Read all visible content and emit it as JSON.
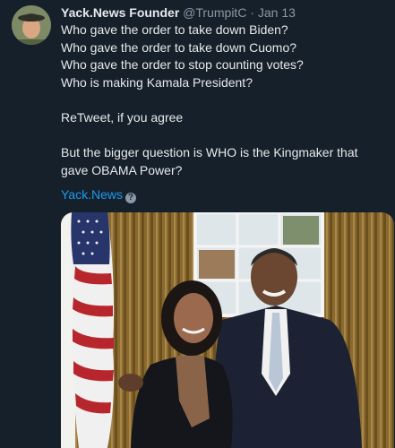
{
  "tweet": {
    "author": "Yack.News Founder",
    "handle": "@TrumpitC",
    "separator": "·",
    "date": "Jan 13",
    "lines": [
      "Who gave the order to take down Biden?",
      "Who gave the order to take down Cuomo?",
      "Who gave the order to stop counting votes?",
      "Who is making Kamala President?",
      "ReTweet, if you agree",
      "But the bigger question is WHO is the Kingmaker that",
      "gave OBAMA Power?"
    ],
    "link_text": "Yack.News",
    "badge_icon": "question-icon",
    "badge_glyph": "?"
  },
  "colors": {
    "background": "#15202b",
    "text": "#e7e9ea",
    "muted": "#8b98a5",
    "link": "#1d9bf0"
  }
}
